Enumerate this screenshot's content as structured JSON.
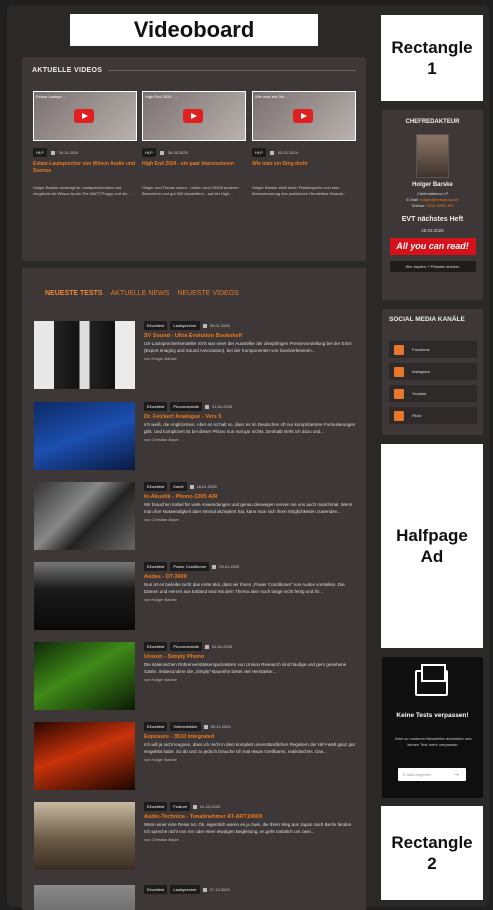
{
  "videoboard": "Videoboard",
  "rect1": [
    "Rectangle",
    "1"
  ],
  "halfpage": [
    "Halfpage",
    "Ad"
  ],
  "rect2": [
    "Rectangle",
    "2"
  ],
  "aktuelle": {
    "heading": "AKTUELLE VIDEOS",
    "videos": [
      {
        "thumb_title": "Exlam-Lautspr...",
        "tag": "HLP",
        "date": "16.11.2024",
        "title": "Exlam-Lautsprecher von Wilson Audio und Sonnos",
        "desc": "Holger Barske schwelgt im Lautsprecherlotus und vergleicht die Wilson Audio The WATT/Puppy und die..."
      },
      {
        "thumb_title": "High End 2024 - ...",
        "tag": "HLP",
        "date": "26.05.2024",
        "title": "High End 2024 - ein paar Impressionen",
        "desc": "Holger und Florian waren - neben rund 20000 anderen Besuchern und gut 500 Ausstellern - auf der High..."
      },
      {
        "thumb_title": "Wie man ein Din...",
        "tag": "HLP",
        "date": "03.02.2024",
        "title": "Wie man ein Ding dreht",
        "desc": "Holger Barske stellt einen Plattenspieler und eine Motorsteuerung des poetischen Herstellers Muarah..."
      }
    ]
  },
  "tabs": [
    "NEUESTE TESTS",
    "AKTUELLE NEWS",
    "NEUESTE VIDEOS"
  ],
  "articles": [
    {
      "tag1": "Einzeltest",
      "tag2": "Lautsprecher",
      "date": "30.01.2025",
      "title": "SV Sound - Ultra Evolution Bookshelf",
      "desc": "US-Lautsprecherhersteller SVS war einer der Aussteller der diesjährigen Pressevorstellung bei der EISA (Expert Imaging and Sound Association), bei der Komponenten von handverlesenen...",
      "author": "von Holger Barske"
    },
    {
      "tag1": "Einzeltest",
      "tag2": "Phonovorstufe",
      "date": "22.01.2025",
      "title": "Dr. Feickert Analogue - Vers 5",
      "desc": "Ich weiß, die Anglizismen. Aber es ist halt so, dass es im Deutschen oft nur kompliziertere Formulierungen gibt. Und kompliziert ist bei dieser Phono nun mal gar nichts. Deshalb steht ich dazu und...",
      "author": "von Christian Bayer"
    },
    {
      "tag1": "Einzeltest",
      "tag2": "Kabel",
      "date": "16.01.2025",
      "title": "In-Akustik - Phono-1205 AIR",
      "desc": "Wir brauchen Kabel für viele Anwendungen und genau deswegen nerven sie uns auch manchmal. Wenn man ihre Notwendigkeit aber einmal akzeptiert hat, kann man sich ihren Möglichkeiten zuwenden...",
      "author": "von Christian Bayer"
    },
    {
      "tag1": "Einzeltest",
      "tag2": "Power Conditioner",
      "date": "09.01.2025",
      "title": "Audes - DT-3600",
      "desc": "Nun ist es beileibe nicht das erste Mal, dass wir Ihnen „Power Conditioner“ von Audes vorstellen. Die Damen und Herren aus Estland sind mit dem Thema aber noch lange nicht fertig und ihr...",
      "author": "von Holger Barske"
    },
    {
      "tag1": "Einzeltest",
      "tag2": "Phonovorstufe",
      "date": "02.01.2025",
      "title": "Unison - Simply Phono",
      "desc": "Die italienischen Röhrenverstärkerspezialisten von Unison Research sind häufige und gern gesehene Gäste. Insbesondere die „Simply“-Baureihe bietet viel Herstärker...",
      "author": "von Holger Barske"
    },
    {
      "tag1": "Einzeltest",
      "tag2": "Vollverstärker",
      "date": "09.12.2024",
      "title": "Exposure - 3510 Integrated",
      "desc": "Ich will ja nicht leugnen, dass ich mich in dem komplett unverständlichen Registern der HiFi-Welt ganz gut eingelebt habe. So ab und zu jedoch brauche ich mal etwas Greifbares, realistisches. Das...",
      "author": "von Holger Barske"
    },
    {
      "tag1": "Einzeltest",
      "tag2": "Feature",
      "date": "01.12.2024",
      "title": "Audio-Technica - Tonabnehmer AT-ART1000X",
      "desc": "Wenn einer eine Reise tut. Ok, eigentlich waren es ja zwei, die Ihren Weg aus Japan nach Berlin fanden. Ich spreche nicht von mir oder einer etwaigen Begleitung, es geht natürlich um zwei...",
      "author": "von Christian Bayer"
    },
    {
      "tag1": "Einzeltest",
      "tag2": "Lautsprecher",
      "date": "17.12.2024",
      "title": "",
      "desc": "",
      "author": ""
    }
  ],
  "chef": {
    "heading": "CHEFREDAKTEUR",
    "name": "Holger Barske",
    "role": "Chefredakteur LP",
    "email_label": "E-Mail:",
    "email": "holger@einsgroup.de",
    "phone_label": "Telefon:",
    "phone": "0203-4292-109",
    "evt": "EVT nächstes Heft",
    "evt_date": "25.03.2025",
    "banner": "All you can read!",
    "buy": "Hier kaufen + Prämien sichern"
  },
  "social": {
    "heading": "SOCIAL MEDIA KANÄLE",
    "items": [
      "Facebook",
      "Instagram",
      "Youtube",
      "Flickr"
    ]
  },
  "newsletter": {
    "heading": "Keine Tests verpassen!",
    "desc": "Jetzt zu unserem Newsletter anmelden und keinen Test mehr verpassen.",
    "placeholder": "E-Mail Angeben",
    "arrow": "→"
  }
}
